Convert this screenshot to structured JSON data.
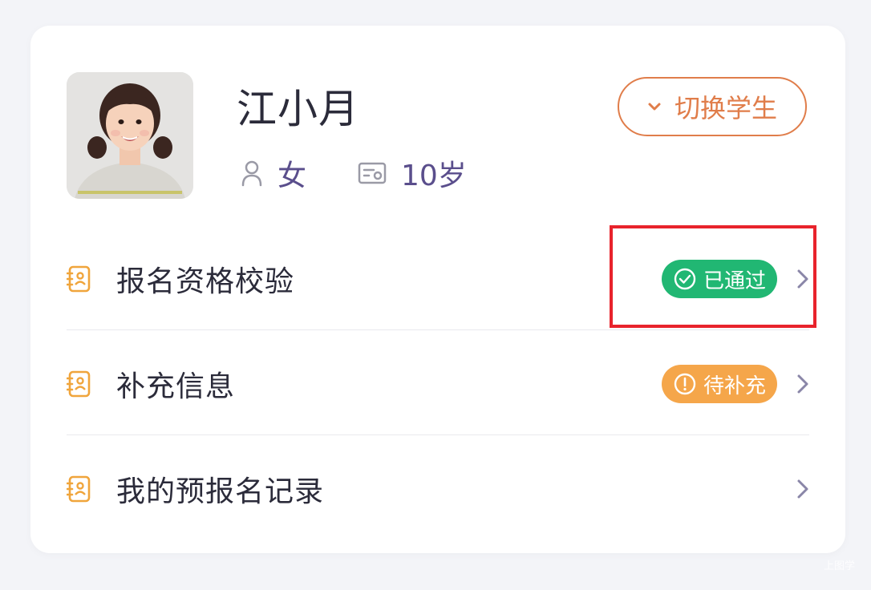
{
  "student": {
    "name": "江小月",
    "gender": "女",
    "age": "10岁",
    "avatar_icon": "student-photo"
  },
  "switch_button": {
    "label": "切换学生",
    "icon": "chevron-down-icon"
  },
  "items": [
    {
      "label": "报名资格校验",
      "badge": "已通过",
      "badge_type": "pass",
      "badge_icon": "check-circle-icon"
    },
    {
      "label": "补充信息",
      "badge": "待补充",
      "badge_type": "pending",
      "badge_icon": "exclamation-circle-icon"
    },
    {
      "label": "我的预报名记录",
      "badge": "",
      "badge_type": "none"
    }
  ],
  "colors": {
    "accent_orange": "#e07d4a",
    "icon_orange": "#f0a53c",
    "pass_green": "#21b773",
    "pending_orange": "#f5a64a",
    "meta_purple": "#5a4e8c",
    "highlight_red": "#e8232c",
    "background": "#f3f4f8"
  },
  "watermark": "上图学"
}
